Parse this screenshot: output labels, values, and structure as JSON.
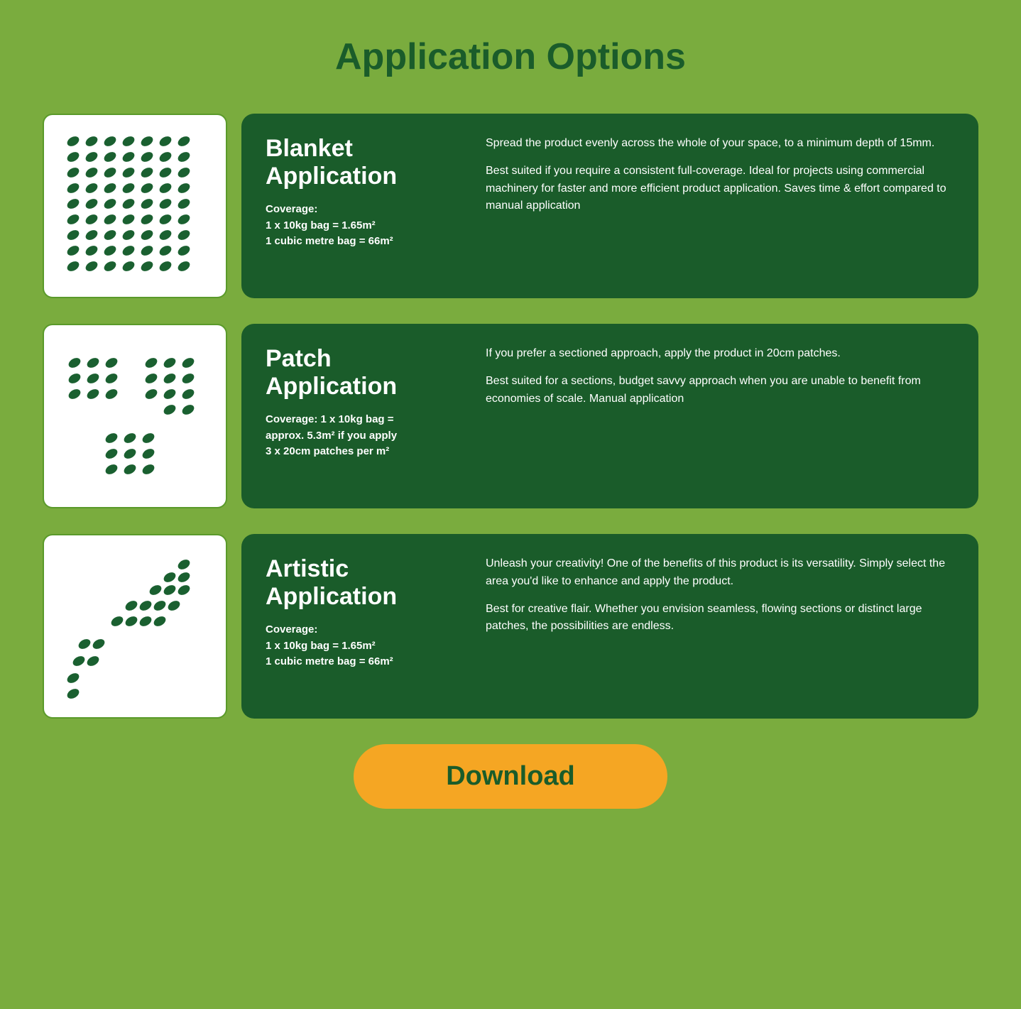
{
  "page": {
    "title": "Application Options",
    "bg_color": "#7aac3e"
  },
  "cards": [
    {
      "id": "blanket",
      "title": "Blanket Application",
      "coverage_label": "Coverage:",
      "coverage_line1": "1 x 10kg bag = 1.65m²",
      "coverage_line2": "1 cubic metre bag = 66m²",
      "desc1": "Spread the product evenly across the whole of your space, to a minimum depth of 15mm.",
      "desc2": "Best suited if you require a consistent full-coverage. Ideal for projects using commercial machinery for faster and more efficient product application. Saves time & effort compared to manual application",
      "pattern": "blanket"
    },
    {
      "id": "patch",
      "title": "Patch Application",
      "coverage_label": "",
      "coverage_line1": "Coverage: 1 x 10kg bag =",
      "coverage_line2": "approx. 5.3m² if you apply",
      "coverage_line3": "3 x 20cm patches per m²",
      "desc1": "If you prefer a sectioned approach, apply the product in 20cm patches.",
      "desc2": "Best suited for a sections, budget savvy approach when you are unable to benefit from economies of scale. Manual application",
      "pattern": "patch"
    },
    {
      "id": "artistic",
      "title": "Artistic Application",
      "coverage_label": "Coverage:",
      "coverage_line1": "1 x 10kg bag = 1.65m²",
      "coverage_line2": "1 cubic metre bag = 66m²",
      "desc1": "Unleash your creativity! One of the benefits of this product is its versatility. Simply select the area you'd like to enhance and apply the product.",
      "desc2": "Best for creative flair. Whether you envision seamless, flowing sections or distinct large patches, the possibilities are endless.",
      "pattern": "artistic"
    }
  ],
  "download": {
    "label": "Download",
    "bg_color": "#f5a623",
    "text_color": "#1a5c2a"
  }
}
